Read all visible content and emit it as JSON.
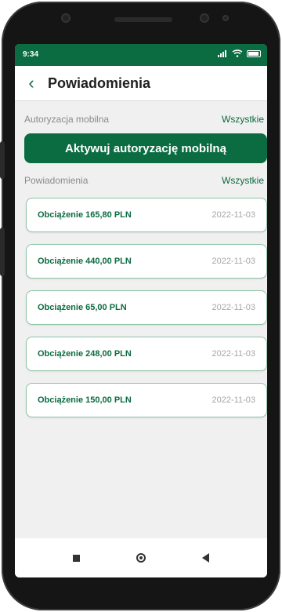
{
  "status_bar": {
    "time": "9:34",
    "background": "#0b6b41"
  },
  "header": {
    "back_icon": "chevron-left-icon",
    "back_glyph": "‹",
    "title": "Powiadomienia"
  },
  "mobile_auth": {
    "section_label": "Autoryzacja mobilna",
    "all_link": "Wszystkie",
    "activate_button": "Aktywuj autoryzację mobilną"
  },
  "notifications": {
    "section_label": "Powiadomienia",
    "all_link": "Wszystkie",
    "items": [
      {
        "title": "Obciążenie 165,80 PLN",
        "date": "2022-11-03"
      },
      {
        "title": "Obciążenie 440,00 PLN",
        "date": "2022-11-03"
      },
      {
        "title": "Obciążenie 65,00 PLN",
        "date": "2022-11-03"
      },
      {
        "title": "Obciążenie 248,00 PLN",
        "date": "2022-11-03"
      },
      {
        "title": "Obciążenie 150,00 PLN",
        "date": "2022-11-03"
      }
    ]
  },
  "colors": {
    "brand_green": "#0b6b41",
    "card_border": "#8fc3a5",
    "muted_text": "#8a8a8a"
  }
}
